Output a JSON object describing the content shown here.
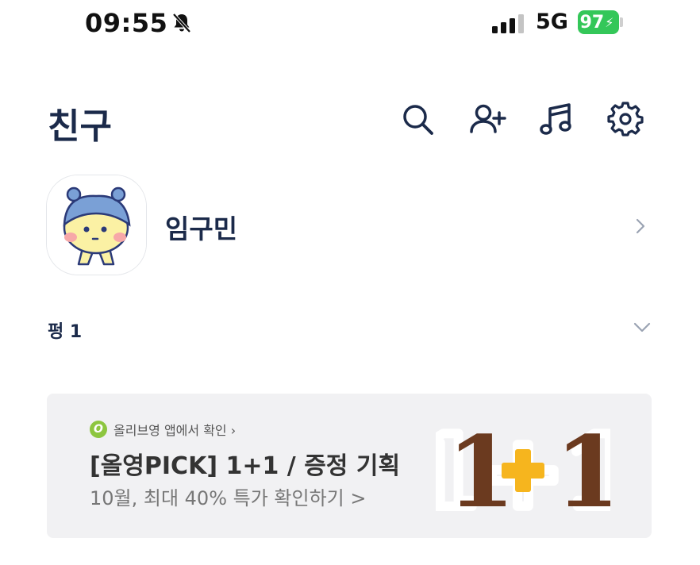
{
  "status_bar": {
    "time": "09:55",
    "network": "5G",
    "battery": "97"
  },
  "header": {
    "title": "친구"
  },
  "profile": {
    "name": "임구민"
  },
  "group": {
    "label": "펑 1"
  },
  "banner": {
    "logo_letter": "O",
    "source": "올리브영 앱에서 확인 ›",
    "title": "[올영PICK] 1+1 / 증정 기획",
    "subtitle": "10월, 최대 40% 특가 확인하기 >",
    "promo": "1+1"
  },
  "colors": {
    "brand_navy": "#1b2a4a",
    "battery_green": "#34c759",
    "banner_bg": "#f1f1f3",
    "olive_green": "#8dc63f",
    "promo_brown": "#6b3a1f",
    "promo_yellow": "#f6b51e"
  },
  "icons": [
    "bell-off-icon",
    "signal-icon",
    "search-icon",
    "add-friend-icon",
    "music-icon",
    "gear-icon",
    "chevron-right-icon",
    "chevron-down-icon"
  ]
}
